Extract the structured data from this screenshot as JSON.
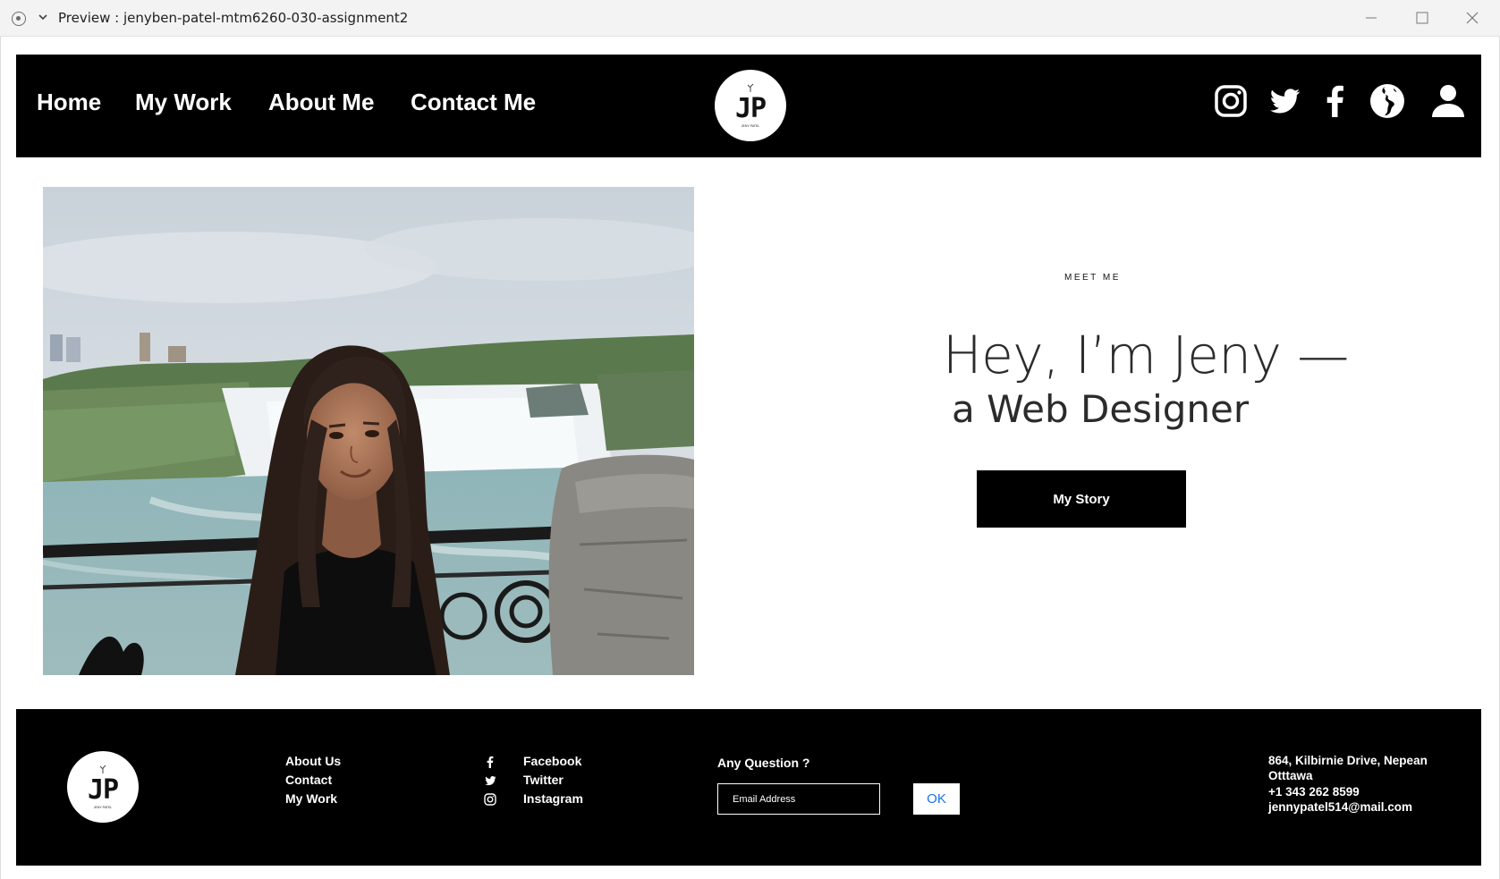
{
  "window": {
    "title": "Preview : jenyben-patel-mtm6260-030-assignment2"
  },
  "header": {
    "nav": [
      "Home",
      "My Work",
      "About Me",
      "Contact Me"
    ],
    "logo": {
      "initials": "JP",
      "subtitle": "JENY PATEL"
    },
    "social_icons": [
      "instagram-icon",
      "twitter-icon",
      "facebook-icon",
      "globe-icon",
      "user-icon"
    ]
  },
  "hero": {
    "eyebrow": "MEET ME",
    "headline_line1": "Hey, I’m Jeny —",
    "headline_line2": "a Web Designer",
    "button_label": "My Story"
  },
  "footer": {
    "links": [
      "About Us",
      "Contact",
      "My Work"
    ],
    "social": [
      {
        "icon": "facebook-icon",
        "label": "Facebook"
      },
      {
        "icon": "twitter-icon",
        "label": "Twitter"
      },
      {
        "icon": "instagram-icon",
        "label": "Instagram"
      }
    ],
    "question": "Any Question ?",
    "email_placeholder": "Email Address",
    "ok_label": "OK",
    "address_line1": "864, Kilbirnie Drive, Nepean",
    "address_line2": "Otttawa",
    "phone": "+1 343 262 8599",
    "email": "jennypatel514@mail.com"
  },
  "colors": {
    "header_bg": "#000000",
    "footer_bg": "#000000",
    "button_bg": "#000000",
    "ok_text": "#1a73e8",
    "headline_text": "#2b2b2b"
  }
}
